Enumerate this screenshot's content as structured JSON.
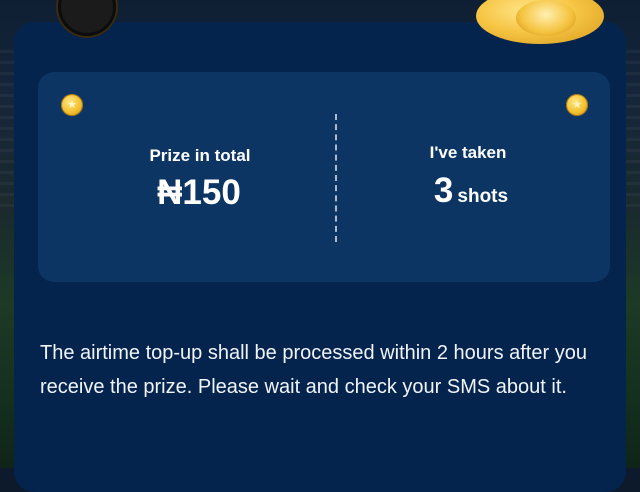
{
  "stats": {
    "prize_label": "Prize in total",
    "prize_value": "₦150",
    "taken_label": "I've taken",
    "shots_count": "3",
    "shots_unit": "shots"
  },
  "notice": {
    "text": "The airtime top-up shall be processed within 2 hours after you receive the prize. Please wait and check your SMS about it."
  },
  "icons": {
    "coin_left": "coin-icon",
    "coin_right": "coin-icon",
    "coin_glyph": "★"
  },
  "colors": {
    "panel": "#04244e",
    "card": "#0c3564",
    "coin": "#f3c02f"
  }
}
